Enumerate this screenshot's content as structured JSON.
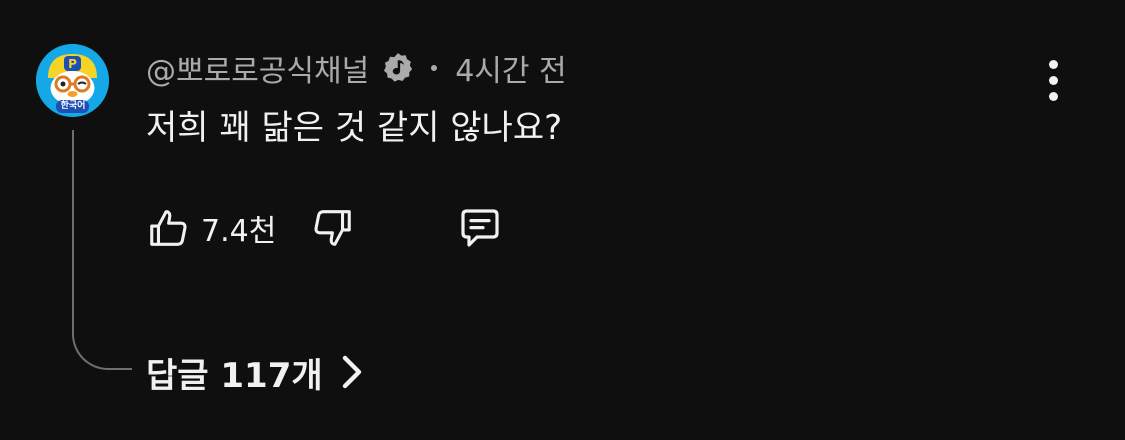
{
  "comment": {
    "author": "@뽀로로공식채널",
    "separator": "•",
    "time": "4시간 전",
    "text": "저희 꽤 닮은 것 같지 않나요?",
    "likes": "7.4천",
    "replies_label": "답글 117개",
    "avatar_caption": "한국어"
  },
  "icons": {
    "verified": "verified-music-note-badge",
    "like": "thumbs-up-icon",
    "dislike": "thumbs-down-icon",
    "reply": "comment-bubble-icon",
    "more": "vertical-ellipsis-icon",
    "chevron": "chevron-right-icon"
  },
  "colors": {
    "background": "#0f0f0f",
    "primary_text": "#f1f1f1",
    "secondary_text": "#aaaaaa",
    "thread_line": "#6f6f6f",
    "avatar_bg": "#14a8e6"
  }
}
